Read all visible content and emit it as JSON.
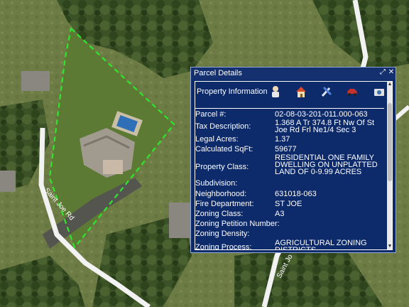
{
  "panel": {
    "title": "Parcel Details",
    "expand_icon": "expand-icon",
    "close_icon": "close-icon"
  },
  "tab": {
    "label": "Property Information",
    "buttons": [
      {
        "name": "owner-icon"
      },
      {
        "name": "home-icon"
      },
      {
        "name": "tools-icon"
      },
      {
        "name": "vehicle-icon"
      },
      {
        "name": "camera-icon"
      }
    ]
  },
  "rows": [
    {
      "label": "Parcel #:",
      "value": "02-08-03-201-011.000-063"
    },
    {
      "label": "Tax Description:",
      "value": "1.368 A Tr 374.8 Ft Nw Of St Joe Rd Frl Ne1/4 Sec 3"
    },
    {
      "label": "Legal Acres:",
      "value": "1.37"
    },
    {
      "label": "Calculated SqFt:",
      "value": "59677"
    },
    {
      "label": "Property Class:",
      "value": "RESIDENTIAL ONE FAMILY DWELLING ON UNPLATTED LAND OF 0-9.99 ACRES"
    },
    {
      "label": "Subdivision:",
      "value": ""
    },
    {
      "label": "Neighborhood:",
      "value": "631018-063"
    },
    {
      "label": "Fire Department:",
      "value": "ST JOE"
    },
    {
      "label": "Zoning Class:",
      "value": "A3"
    },
    {
      "label": "Zoning Petition Number:",
      "value": ""
    },
    {
      "label": "Zoning Density:",
      "value": ""
    },
    {
      "label": "Zoning Process:",
      "value": "AGRICULTURAL ZONING DISTRICTS"
    }
  ],
  "map": {
    "road_label_left": "Saint Joe Rd",
    "road_label_right": "Saint Jo",
    "parcel_outline_color": "#2ee62e"
  }
}
